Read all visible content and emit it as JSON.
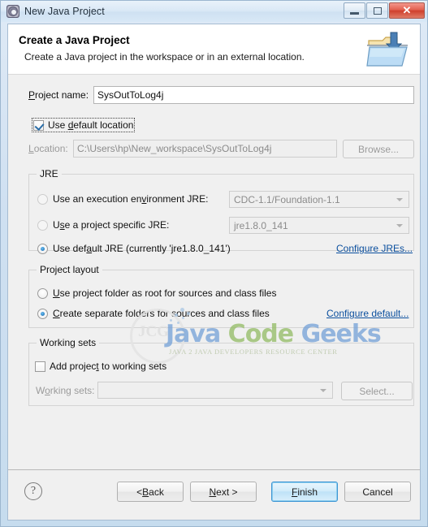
{
  "window": {
    "title": "New Java Project",
    "icon": "java-project-icon",
    "buttons": {
      "minimize": "minimize-icon",
      "maximize": "maximize-icon",
      "close": "✕"
    }
  },
  "header": {
    "title": "Create a Java Project",
    "description": "Create a Java project in the workspace or in an external location.",
    "icon": "new-java-project-folder-icon"
  },
  "project": {
    "name_label": "Project name:",
    "name_value": "SysOutToLog4j",
    "name_placeholder": "",
    "use_default_location_label": "Use default location",
    "use_default_location_checked": true,
    "location_label": "Location:",
    "location_value": "C:\\Users\\hp\\New_workspace\\SysOutToLog4j",
    "browse_label": "Browse..."
  },
  "jre": {
    "group_title": "JRE",
    "options": [
      {
        "label": "Use an execution environment JRE:",
        "selected": false,
        "enabled": false,
        "combo_value": "CDC-1.1/Foundation-1.1"
      },
      {
        "label": "Use a project specific JRE:",
        "selected": false,
        "enabled": false,
        "combo_value": "jre1.8.0_141"
      },
      {
        "label": "Use default JRE (currently 'jre1.8.0_141')",
        "selected": true,
        "enabled": true,
        "combo_value": ""
      }
    ],
    "configure_link": "Configure JREs..."
  },
  "project_layout": {
    "group_title": "Project layout",
    "options": [
      {
        "label": "Use project folder as root for sources and class files",
        "selected": false
      },
      {
        "label": "Create separate folders for sources and class files",
        "selected": true
      }
    ],
    "configure_link": "Configure default..."
  },
  "working_sets": {
    "group_title": "Working sets",
    "add_label": "Add project to working sets",
    "add_checked": false,
    "sets_label": "Working sets:",
    "sets_value": "",
    "select_label": "Select..."
  },
  "footer": {
    "help": "?",
    "back": "< Back",
    "next": "Next >",
    "finish": "Finish",
    "cancel": "Cancel"
  },
  "watermark": {
    "part1": "Java",
    "part2": "Code",
    "part3": "Geeks",
    "subtitle": "JAVA 2 JAVA DEVELOPERS RESOURCE CENTER",
    "monogram": "JCG"
  },
  "colors": {
    "accent": "#0b4f9e",
    "default_button_border": "#3c94d4",
    "close_button": "#cf3f2c",
    "watermark_blue": "#6f9ed6",
    "watermark_green": "#8fba5e"
  }
}
